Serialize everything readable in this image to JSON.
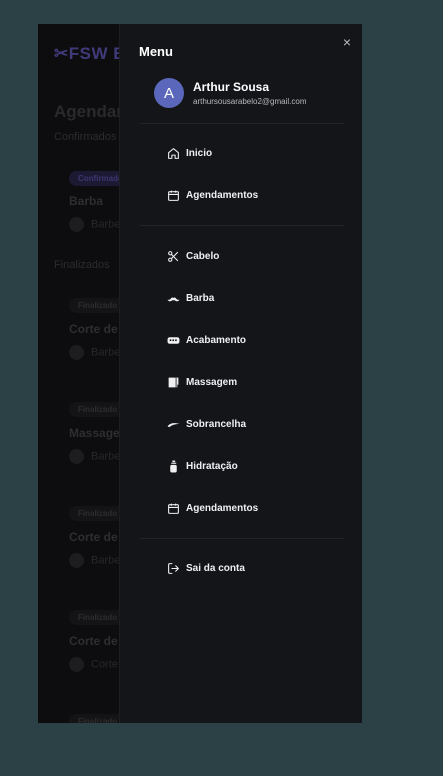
{
  "background": {
    "logo": "✂FSW BAR",
    "title": "Agendam",
    "confirmed_label": "Confirmados",
    "confirmed_badge": "Confirmado",
    "confirmed_item": "Barba",
    "confirmed_sub": "Barbe",
    "finished_label": "Finalizados",
    "finished": [
      {
        "badge": "Finalizado",
        "item": "Corte de",
        "sub": "Barbe"
      },
      {
        "badge": "Finalizado",
        "item": "Massage",
        "sub": "Barbe"
      },
      {
        "badge": "Finalizado",
        "item": "Corte de",
        "sub": "Barbe"
      },
      {
        "badge": "Finalizado",
        "item": "Corte de",
        "sub": "Corte"
      },
      {
        "badge": "Finalizado",
        "item": "",
        "sub": ""
      }
    ]
  },
  "drawer": {
    "title": "Menu",
    "close_icon": "×",
    "user": {
      "initial": "A",
      "name": "Arthur Sousa",
      "email": "arthursousarabelo2@gmail.com"
    },
    "nav": [
      {
        "label": "Inicio",
        "icon": "home-icon"
      },
      {
        "label": "Agendamentos",
        "icon": "calendar-icon"
      }
    ],
    "services": [
      {
        "label": "Cabelo",
        "icon": "scissors-icon"
      },
      {
        "label": "Barba",
        "icon": "mustache-icon"
      },
      {
        "label": "Acabamento",
        "icon": "trimmer-icon"
      },
      {
        "label": "Massagem",
        "icon": "towel-icon"
      },
      {
        "label": "Sobrancelha",
        "icon": "eyebrow-icon"
      },
      {
        "label": "Hidratação",
        "icon": "bottle-icon"
      },
      {
        "label": "Agendamentos",
        "icon": "calendar-icon"
      }
    ],
    "logout": {
      "label": "Sai da conta",
      "icon": "logout-icon"
    }
  }
}
